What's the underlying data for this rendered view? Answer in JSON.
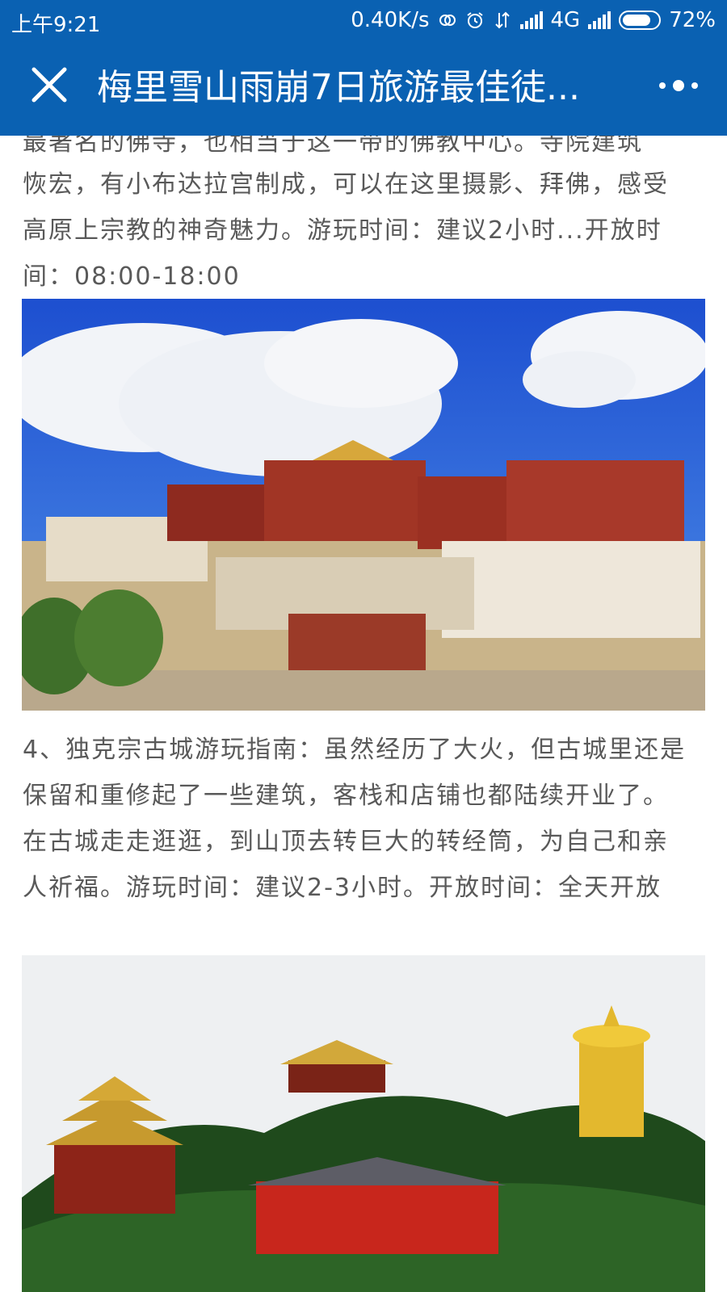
{
  "status_bar": {
    "time": "上午9:21",
    "network_speed": "0.40K/s",
    "network_type": "4G",
    "battery_percent": "72%",
    "battery_level": 0.72,
    "icons": [
      "hd-icon",
      "alarm-icon",
      "data-transfer-icon",
      "signal-icon",
      "signal-icon-2",
      "battery-icon"
    ]
  },
  "header": {
    "title": "梅里雪山雨崩7日旅游最佳徒...",
    "close_icon": "close-icon",
    "more_icon": "more-icon",
    "background": "#0a61b2"
  },
  "article": {
    "para1_top_cut": "最著名的佛寺，也相当于这一带的佛教中心。寺院建筑",
    "para1": "恢宏，有小布达拉宫制成，可以在这里摄影、拜佛，感受高原上宗教的神奇魅力。游玩时间：建议2小时...开放时间：08:00-18:00",
    "para2": "4、独克宗古城游玩指南：虽然经历了大火，但古城里还是保留和重修起了一些建筑，客栈和店铺也都陆续开业了。在古城走走逛逛，到山顶去转巨大的转经筒，为自己和亲人祈福。游玩时间：建议2-3小时。开放时间：全天开放"
  },
  "colors": {
    "text": "#595959",
    "accent": "#0a61b2"
  }
}
